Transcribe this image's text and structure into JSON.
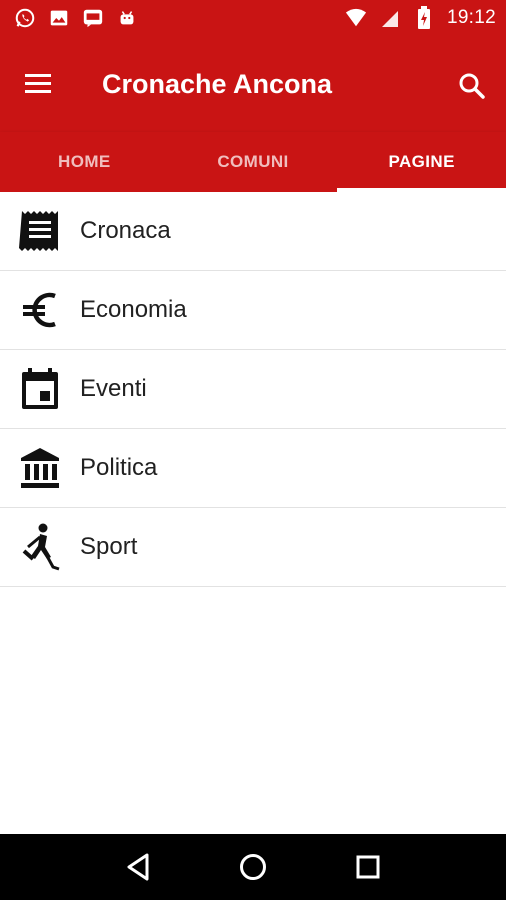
{
  "status_bar": {
    "time": "19:12",
    "left_icons": [
      "whatsapp-icon",
      "image-icon",
      "chat-icon",
      "android-icon"
    ],
    "right_icons": [
      "wifi-icon",
      "cell-signal-icon",
      "battery-charging-icon"
    ]
  },
  "toolbar": {
    "title": "Cronache Ancona",
    "menu_icon": "menu-icon",
    "search_icon": "search-icon",
    "color": "#c91414"
  },
  "tabs": [
    {
      "label": "HOME",
      "active": false
    },
    {
      "label": "COMUNI",
      "active": false
    },
    {
      "label": "PAGINE",
      "active": true
    }
  ],
  "list": {
    "items": [
      {
        "label": "Cronaca",
        "icon": "receipt-icon"
      },
      {
        "label": "Economia",
        "icon": "euro-icon"
      },
      {
        "label": "Eventi",
        "icon": "calendar-icon"
      },
      {
        "label": "Politica",
        "icon": "government-building-icon"
      },
      {
        "label": "Sport",
        "icon": "hockey-player-icon"
      }
    ]
  },
  "nav_bar": {
    "buttons": [
      "back-icon",
      "home-icon",
      "recents-icon"
    ]
  }
}
